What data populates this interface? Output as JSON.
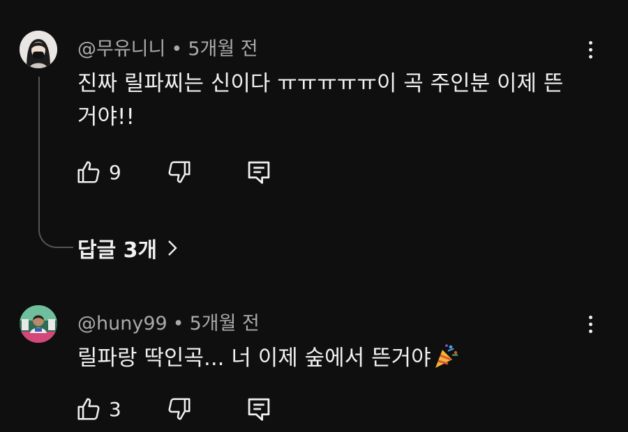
{
  "comments": [
    {
      "handle": "@무유니니",
      "separator": "•",
      "time": "5개월 전",
      "text": "진짜 릴파찌는 신이다 ㅠㅠㅠㅠㅠ이 곡  주인분 이제 뜬거야!!",
      "likes": "9",
      "replies_label": "답글 3개"
    },
    {
      "handle": "@huny99",
      "separator": "•",
      "time": "5개월 전",
      "text": "릴파랑 딱인곡...  너 이제 숲에서 뜬거야",
      "emoji": "party-popper-icon",
      "likes": "3"
    }
  ],
  "colors": {
    "background": "#0f0f0f",
    "primary_text": "#f1f1f1",
    "secondary_text": "#aaaaaa",
    "thread_line": "#555555"
  }
}
